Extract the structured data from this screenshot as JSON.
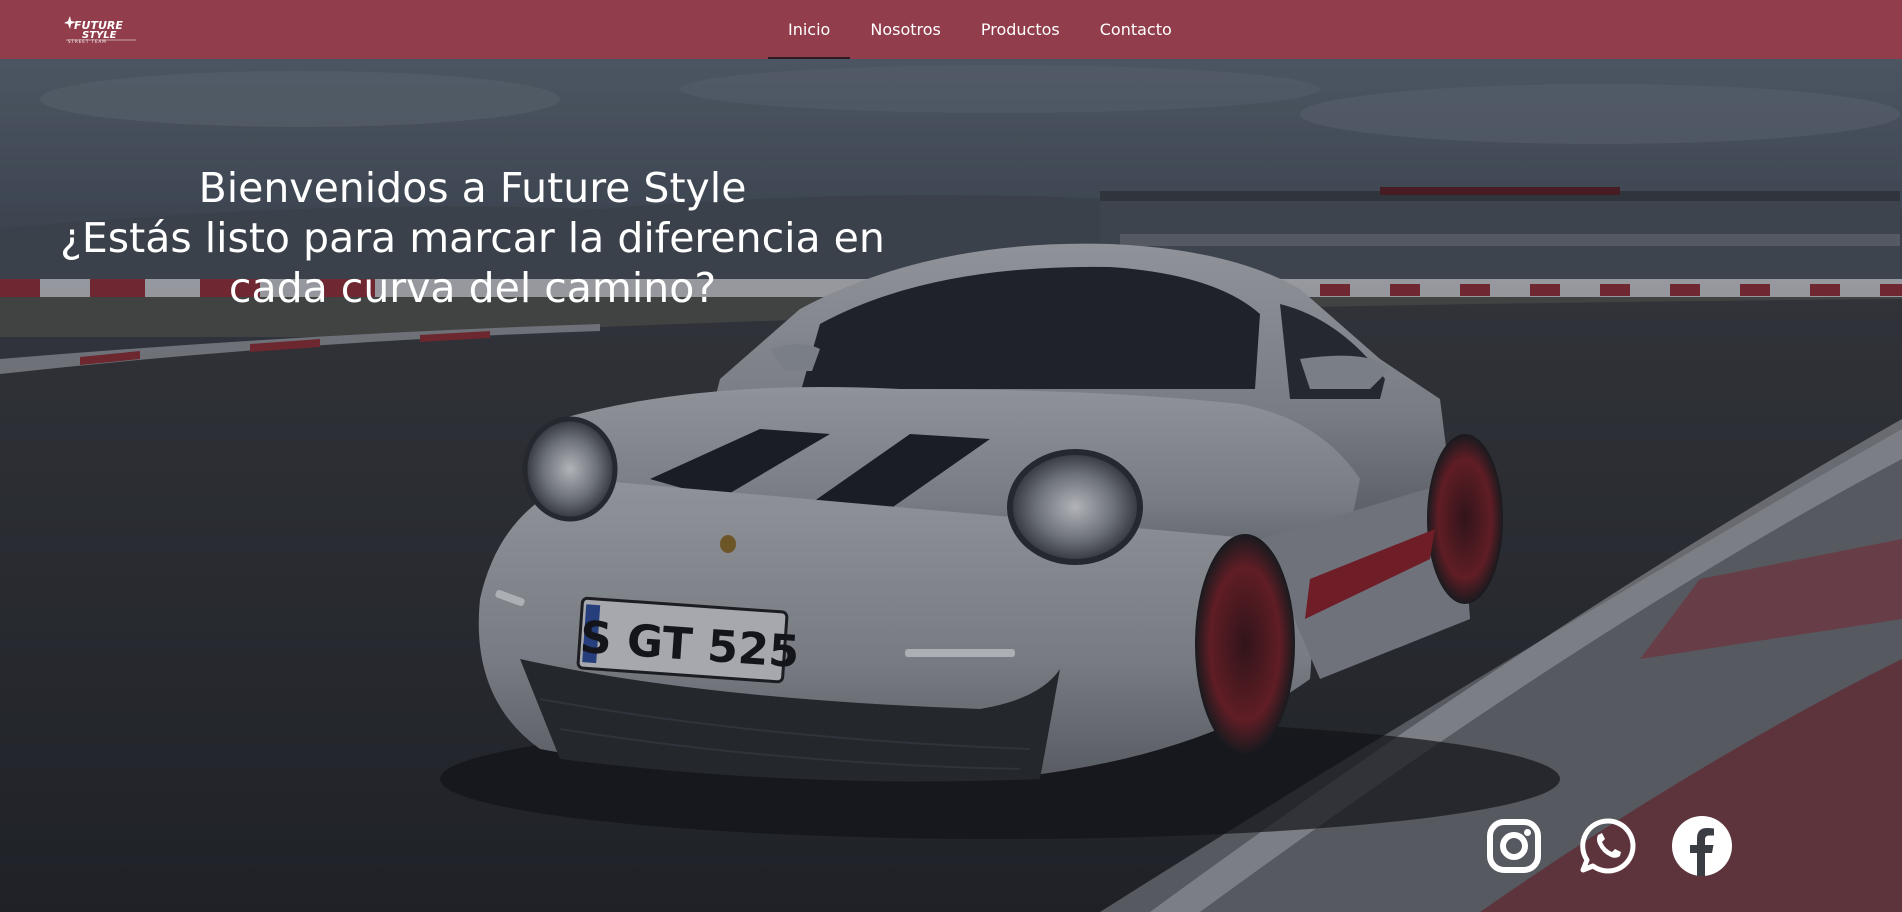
{
  "header": {
    "logo": {
      "text_line1": "FUTURE",
      "text_line2": "STYLE",
      "tagline": "STREET TEAM"
    },
    "nav": [
      {
        "label": "Inicio",
        "active": true
      },
      {
        "label": "Nosotros",
        "active": false
      },
      {
        "label": "Productos",
        "active": false
      },
      {
        "label": "Contacto",
        "active": false
      }
    ],
    "background_color": "#913d4b"
  },
  "hero": {
    "title_line1": "Bienvenidos a Future Style",
    "title_line2": "¿Estás listo para marcar la diferencia en",
    "title_line3": "cada curva del camino?",
    "plate_text": "S GT 525"
  },
  "social": [
    {
      "name": "instagram",
      "icon": "instagram-icon"
    },
    {
      "name": "whatsapp",
      "icon": "whatsapp-icon"
    },
    {
      "name": "facebook",
      "icon": "facebook-icon"
    }
  ]
}
